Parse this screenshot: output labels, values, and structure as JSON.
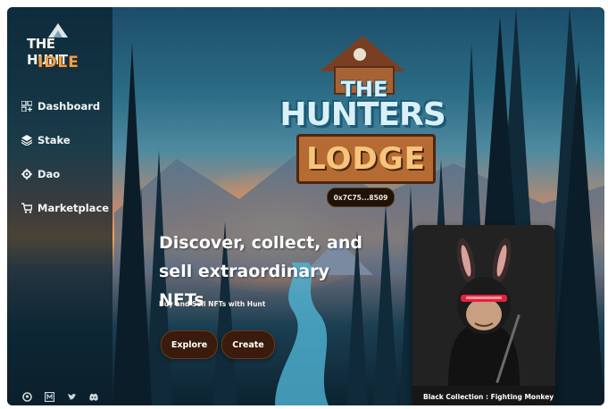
{
  "brand": {
    "line1": "THE HUNT",
    "line2": "IDLE"
  },
  "sidebar": {
    "items": [
      {
        "label": "Dashboard",
        "icon": "dashboard-icon"
      },
      {
        "label": "Stake",
        "icon": "layers-icon"
      },
      {
        "label": "Dao",
        "icon": "gear-icon"
      },
      {
        "label": "Marketplace",
        "icon": "cart-icon"
      }
    ],
    "socials": [
      "github-icon",
      "medium-icon",
      "twitter-icon",
      "discord-icon"
    ]
  },
  "header": {
    "logo_line1": "THE",
    "logo_line2": "HUNTERS",
    "logo_line3": "LODGE",
    "wallet": "0x7C75...8509"
  },
  "hero": {
    "title": "Discover, collect, and sell extraordinary NFTs",
    "subtitle": "Buy and Sell NFTs with Hunt",
    "explore_label": "Explore",
    "create_label": "Create"
  },
  "nft": {
    "caption": "Black Collection : Fighting Monkey"
  },
  "colors": {
    "accent": "#3a1b0c",
    "sky": "#2c6d86",
    "sunset": "#f0a25a"
  }
}
